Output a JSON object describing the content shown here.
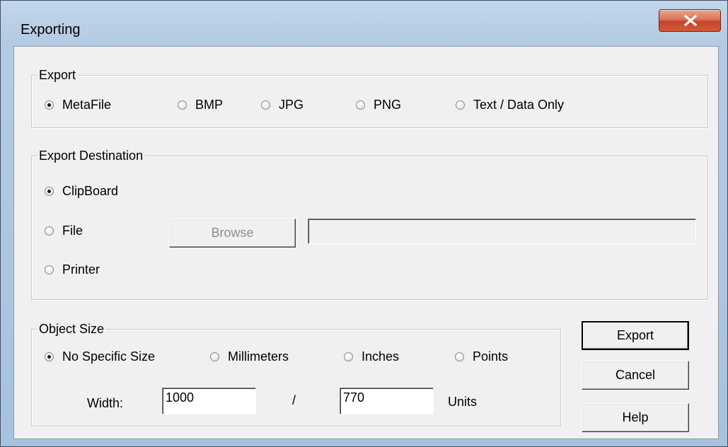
{
  "window": {
    "title": "Exporting"
  },
  "export_group": {
    "title": "Export",
    "options": [
      {
        "label": "MetaFile",
        "checked": true
      },
      {
        "label": "BMP",
        "checked": false
      },
      {
        "label": "JPG",
        "checked": false
      },
      {
        "label": "PNG",
        "checked": false
      },
      {
        "label": "Text / Data Only",
        "checked": false
      }
    ]
  },
  "destination_group": {
    "title": "Export Destination",
    "options": [
      {
        "label": "ClipBoard",
        "checked": true
      },
      {
        "label": "File",
        "checked": false
      },
      {
        "label": "Printer",
        "checked": false
      }
    ],
    "browse_label": "Browse",
    "file_path": ""
  },
  "size_group": {
    "title": "Object Size",
    "options": [
      {
        "label": "No Specific Size",
        "checked": true
      },
      {
        "label": "Millimeters",
        "checked": false
      },
      {
        "label": "Inches",
        "checked": false
      },
      {
        "label": "Points",
        "checked": false
      }
    ],
    "width_label": "Width:",
    "width_value": "1000",
    "separator": "/",
    "height_value": "770",
    "units_label": "Units"
  },
  "buttons": {
    "export": "Export",
    "cancel": "Cancel",
    "help": "Help"
  }
}
